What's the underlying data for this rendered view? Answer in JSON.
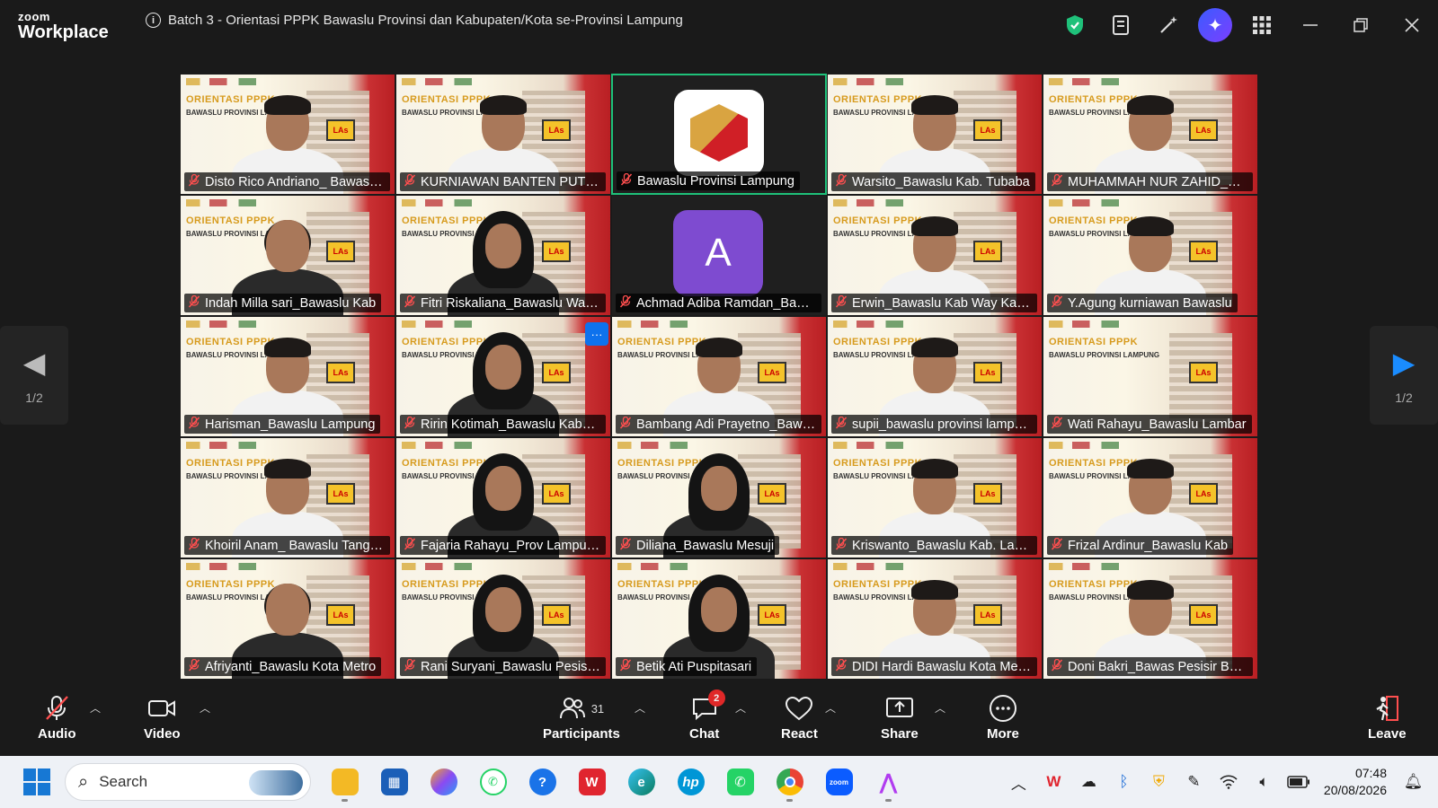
{
  "app": {
    "logo_top": "zoom",
    "logo_bottom": "Workplace"
  },
  "meeting": {
    "title": "Batch 3 - Orientasi PPPK Bawaslu Provinsi dan Kabupaten/Kota se-Provinsi Lampung"
  },
  "tile_banner": {
    "line1": "ORIENTASI PPPK",
    "line2": "BAWASLU PROVINSI LAMPUNG",
    "sign": "LAs"
  },
  "participants_grid": [
    {
      "name": "Disto Rico Andriano_ Bawaslu Kab. Way Kanan",
      "type": "video",
      "look": "man"
    },
    {
      "name": "KURNIAWAN BANTEN PUTRA_Bawaslu",
      "type": "video",
      "look": "man"
    },
    {
      "name": "Bawaslu Provinsi Lampung",
      "type": "logo",
      "look": "logo"
    },
    {
      "name": "Warsito_Bawaslu Kab. Tubaba",
      "type": "video",
      "look": "man"
    },
    {
      "name": "MUHAMMAH NUR ZAHID_Bawaslu",
      "type": "video",
      "look": "man"
    },
    {
      "name": "Indah Milla sari_Bawaslu Kab",
      "type": "video",
      "look": "woman"
    },
    {
      "name": "Fitri Riskaliana_Bawaslu Way Kanan",
      "type": "video",
      "look": "hijab"
    },
    {
      "name": "Achmad Adiba Ramdan_Bawaslu",
      "type": "letter",
      "letter": "A"
    },
    {
      "name": "Erwin_Bawaslu Kab Way Kanan",
      "type": "video",
      "look": "man"
    },
    {
      "name": "Y.Agung kurniawan Bawaslu",
      "type": "video",
      "look": "man"
    },
    {
      "name": "Harisman_Bawaslu Lampung",
      "type": "video",
      "look": "man"
    },
    {
      "name": "Ririn Kotimah_Bawaslu Kabupaten",
      "type": "video",
      "look": "hijab"
    },
    {
      "name": "Bambang Adi Prayetno_Bawaslu",
      "type": "video",
      "look": "man"
    },
    {
      "name": "supii_bawaslu provinsi lampung",
      "type": "video",
      "look": "man"
    },
    {
      "name": "Wati Rahayu_Bawaslu Lambar",
      "type": "video",
      "look": "none"
    },
    {
      "name": "Khoiril Anam_ Bawaslu Tanggamus",
      "type": "video",
      "look": "man"
    },
    {
      "name": "Fajaria Rahayu_Prov Lampung",
      "type": "video",
      "look": "hijab"
    },
    {
      "name": "Diliana_Bawaslu Mesuji",
      "type": "video",
      "look": "hijab"
    },
    {
      "name": "Kriswanto_Bawaslu Kab. Lampung",
      "type": "video",
      "look": "man"
    },
    {
      "name": "Frizal Ardinur_Bawaslu Kab",
      "type": "video",
      "look": "man"
    },
    {
      "name": "Afriyanti_Bawaslu Kota Metro",
      "type": "video",
      "look": "woman"
    },
    {
      "name": "Rani Suryani_Bawaslu Pesisir Barat",
      "type": "video",
      "look": "hijab"
    },
    {
      "name": "Betik Ati Puspitasari",
      "type": "video",
      "look": "hijab"
    },
    {
      "name": "DIDI Hardi Bawaslu Kota Metro",
      "type": "video",
      "look": "man"
    },
    {
      "name": "Doni Bakri_Bawas Pesisir Barat",
      "type": "video",
      "look": "man"
    }
  ],
  "pagination": {
    "left_label": "1/2",
    "right_label": "1/2"
  },
  "toolbar": {
    "audio": "Audio",
    "video": "Video",
    "participants": "Participants",
    "participants_count": "31",
    "chat": "Chat",
    "chat_badge": "2",
    "react": "React",
    "share": "Share",
    "more": "More",
    "leave": "Leave"
  },
  "taskbar": {
    "search_placeholder": "Search",
    "time": "07:48",
    "date": "20/08/2026"
  },
  "colors": {
    "active_speaker_border": "#1fc17a",
    "muted_mic": "#ff4f4f",
    "chat_badge": "#e02828",
    "nav_arrow": "#1a8cff"
  }
}
